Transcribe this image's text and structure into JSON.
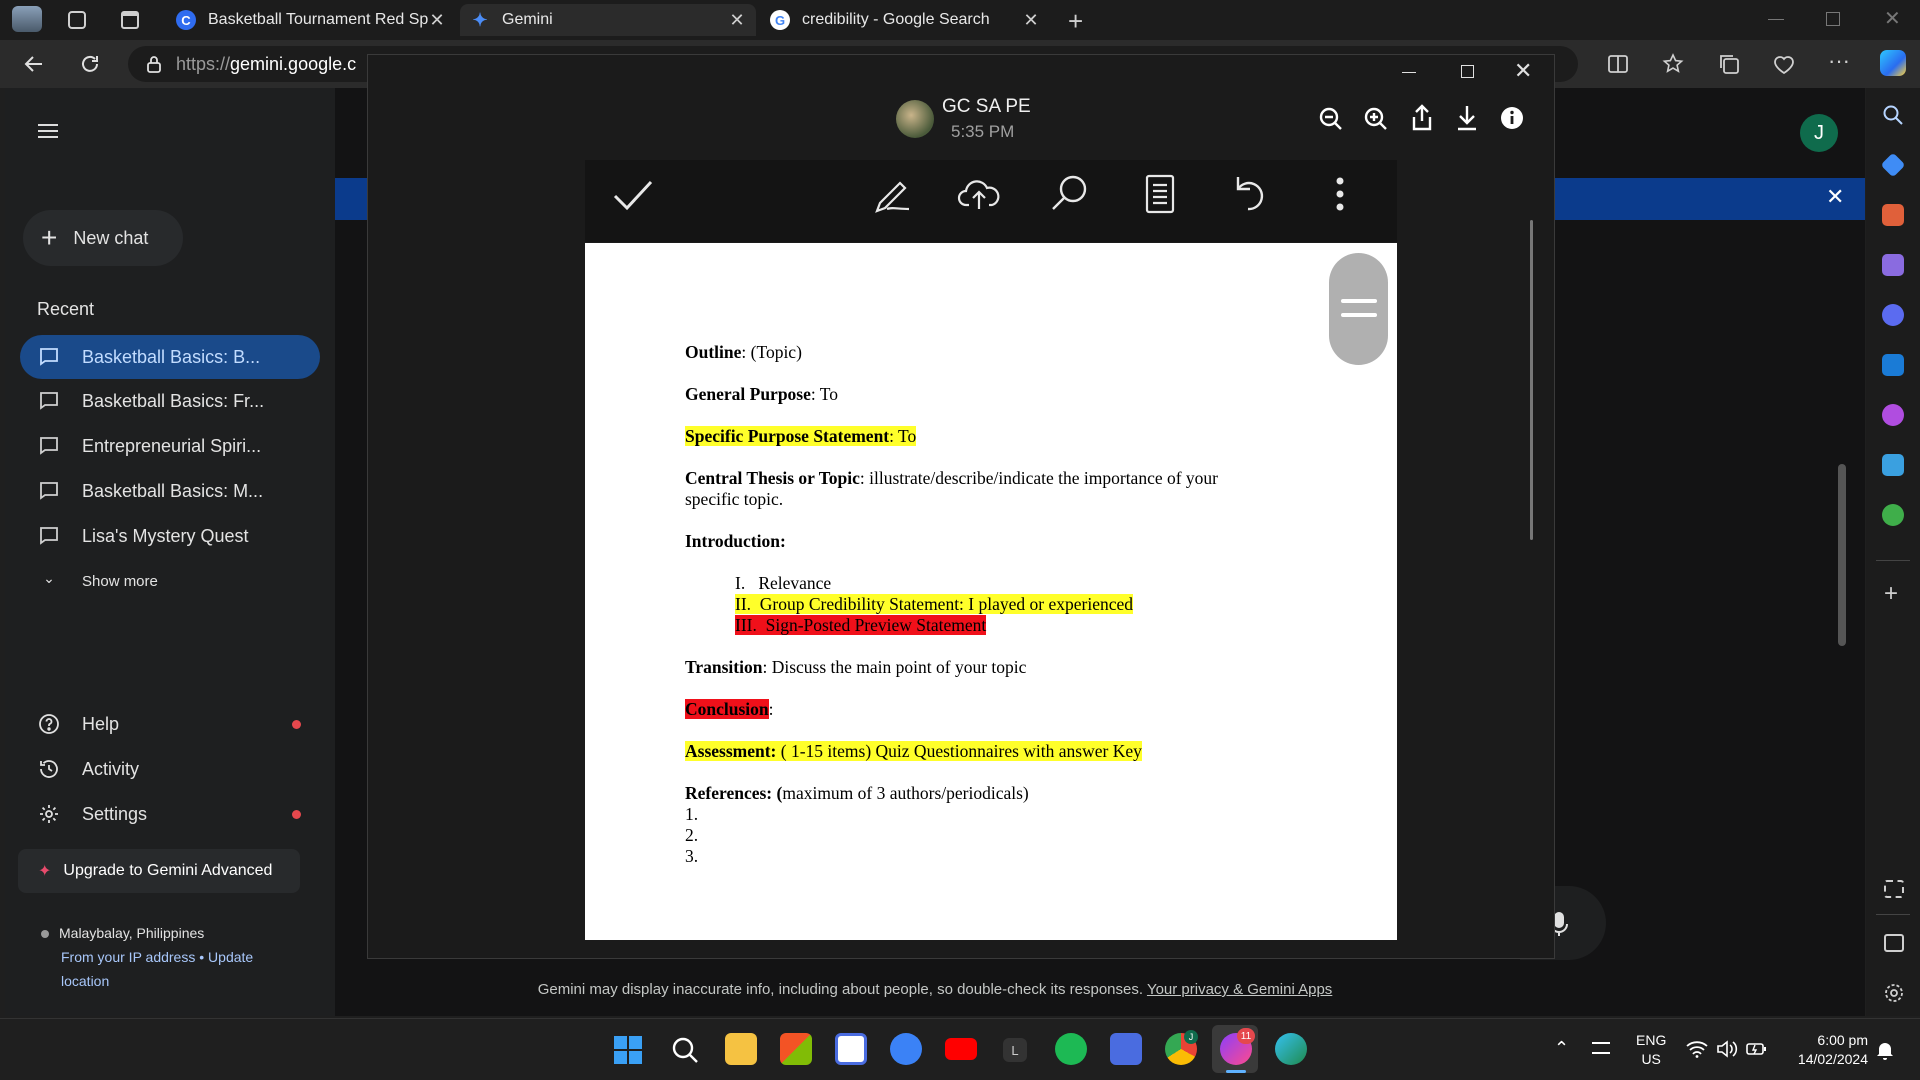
{
  "browser": {
    "tabs": [
      {
        "title": "Basketball Tournament Red Spor",
        "favicon": "C",
        "favicon_color": "#2f6cf0"
      },
      {
        "title": "Gemini",
        "favicon": "✦",
        "favicon_color": "#4b8cf5"
      },
      {
        "title": "credibility - Google Search",
        "favicon": "G",
        "favicon_color": "#ffffff"
      }
    ],
    "url_scheme": "https://",
    "url_host": "gemini.google.c"
  },
  "sidebar": {
    "new_chat": "New chat",
    "recent_label": "Recent",
    "items": [
      {
        "label": "Basketball Basics: B..."
      },
      {
        "label": "Basketball Basics: Fr..."
      },
      {
        "label": "Entrepreneurial Spiri..."
      },
      {
        "label": "Basketball Basics: M..."
      },
      {
        "label": "Lisa's Mystery Quest"
      }
    ],
    "show_more": "Show more",
    "help": "Help",
    "activity": "Activity",
    "settings": "Settings",
    "upgrade": "Upgrade to Gemini Advanced",
    "location_place": "Malaybalay, Philippines",
    "location_source": "From your IP address",
    "location_separator": "•",
    "location_update_1": "Update",
    "location_update_2": "location"
  },
  "gemini": {
    "avatar_letter": "J",
    "disclaimer": "Gemini may display inaccurate info, including about people, so double-check its responses.",
    "privacy_link": "Your privacy & Gemini Apps"
  },
  "viewer": {
    "sender": "GC SA PE",
    "time": "5:35 PM"
  },
  "document": {
    "outline_label": "Outline",
    "outline_value": ": (Topic)",
    "general_purpose_label": "General Purpose",
    "general_purpose_value": ": To",
    "specific_purpose_label": "Specific Purpose Statement",
    "specific_purpose_value": ": To",
    "central_thesis_label": "Central Thesis or Topic",
    "central_thesis_value": ": illustrate/describe/indicate the importance of your",
    "central_thesis_cont": "specific topic.",
    "introduction_label": "Introduction:",
    "intro_items": [
      "I.   Relevance",
      "II.  Group Credibility Statement: I played or experienced",
      "III.  Sign-Posted Preview Statement"
    ],
    "transition_label": "Transition",
    "transition_value": ": Discuss the main point of your topic",
    "conclusion_label": "Conclusion",
    "conclusion_colon": ":",
    "assessment_label": "Assessment:",
    "assessment_value": " ( 1-15 items) Quiz Questionnaires with answer Key",
    "references_label": "References: (",
    "references_value": "maximum of 3 authors/periodicals)",
    "reference_numbers": [
      "1.",
      "2.",
      "3."
    ]
  },
  "taskbar": {
    "language": "ENG",
    "region": "US",
    "time": "6:00 pm",
    "date": "14/02/2024",
    "messenger_badge": "11",
    "chrome_badge": "J",
    "app_letter": "L"
  }
}
